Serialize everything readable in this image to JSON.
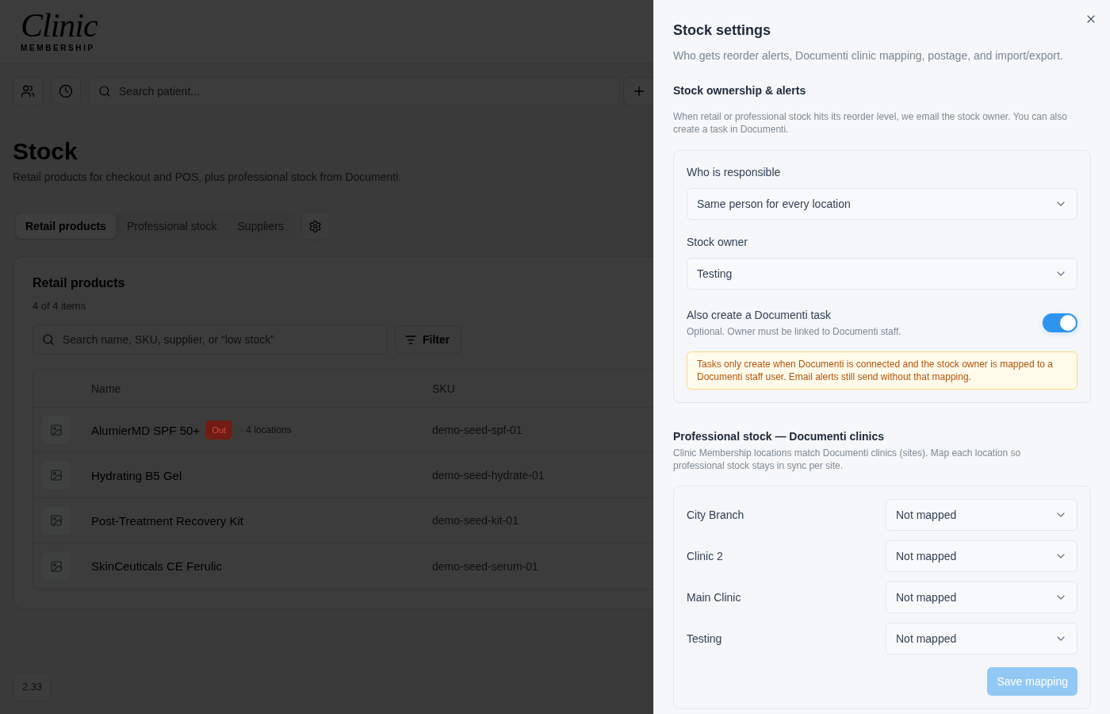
{
  "header": {
    "logo": {
      "script": "Clinic",
      "tagline": "MEMBERSHIP"
    }
  },
  "toolbar": {
    "search": {
      "placeholder": "Search patient..."
    }
  },
  "page": {
    "title": "Stock",
    "subtitle": "Retail products for checkout and POS, plus professional stock from Documenti."
  },
  "tabs": [
    {
      "label": "Retail products",
      "selected": true
    },
    {
      "label": "Professional stock",
      "selected": false
    },
    {
      "label": "Suppliers",
      "selected": false
    }
  ],
  "products_card": {
    "title": "Retail products",
    "count": "4 of 4 items",
    "search": {
      "placeholder": "Search name, SKU, supplier, or “low stock”"
    },
    "filter_button": "Filter",
    "table": {
      "columns": [
        "Name",
        "SKU"
      ],
      "rows": [
        {
          "name": "AlumierMD SPF 50+",
          "badge": "Out",
          "locations": "· 4 locations",
          "sku": "demo-seed-spf-01"
        },
        {
          "name": "Hydrating B5 Gel",
          "sku": "demo-seed-hydrate-01"
        },
        {
          "name": "Post-Treatment Recovery Kit",
          "sku": "demo-seed-kit-01"
        },
        {
          "name": "SkinCeuticals CE Ferulic",
          "sku": "demo-seed-serum-01"
        }
      ]
    }
  },
  "version": "2.33",
  "drawer": {
    "title": "Stock settings",
    "subtitle": "Who gets reorder alerts, Documenti clinic mapping, postage, and import/export.",
    "ownership": {
      "heading": "Stock ownership & alerts",
      "description": "When retail or professional stock hits its reorder level, we email the stock owner. You can also create a task in Documenti.",
      "fields": [
        {
          "label": "Who is responsible",
          "value": "Same person for every location"
        },
        {
          "label": "Stock owner",
          "value": "Testing"
        }
      ],
      "task_toggle": {
        "label": "Also create a Documenti task",
        "hint": "Optional. Owner must be linked to Documenti staff.",
        "on": true
      },
      "notice": "Tasks only create when Documenti is connected and the stock owner is mapped to a Documenti staff user. Email alerts still send without that mapping."
    },
    "mapping": {
      "heading": "Professional stock — Documenti clinics",
      "description": "Clinic Membership locations match Documenti clinics (sites). Map each location so professional stock stays in sync per site.",
      "rows": [
        {
          "location": "City Branch",
          "value": "Not mapped"
        },
        {
          "location": "Clinic 2",
          "value": "Not mapped"
        },
        {
          "location": "Main Clinic",
          "value": "Not mapped"
        },
        {
          "location": "Testing",
          "value": "Not mapped"
        }
      ],
      "save_button": {
        "label": "Save mapping",
        "disabled": true
      }
    }
  }
}
